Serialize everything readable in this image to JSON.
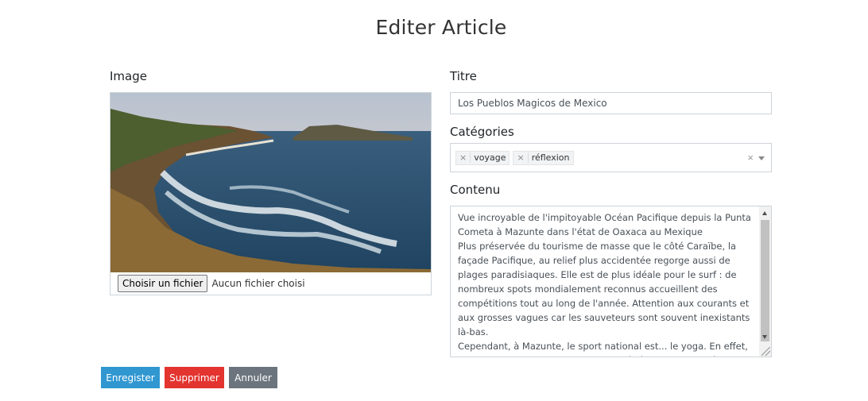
{
  "page": {
    "title": "Editer Article"
  },
  "form": {
    "image_label": "Image",
    "title_label": "Titre",
    "title_value": "Los Pueblos Magicos de Mexico",
    "categories_label": "Catégories",
    "categories": [
      "voyage",
      "réflexion"
    ],
    "content_label": "Contenu",
    "content_value": "Vue incroyable de l'impitoyable Océan Pacifique depuis la Punta Cometa à Mazunte dans l'état de Oaxaca au Mexique\nPlus préservée du tourisme de masse que le côté Caraïbe, la façade Pacifique, au relief plus accidentée regorge aussi de plages paradisiaques. Elle est de plus idéale pour le surf : de nombreux spots mondialement reconnus accueillent des compétitions tout au long de l'année. Attention aux courants et aux grosses vagues car les sauveteurs sont souvent inexistants là-bas.\nCependant, à Mazunte, le sport national est... le yoga. En effet, entre ambiance baba cool et climat rêvé, le cadre se prête parfaitement à la"
  },
  "file_input": {
    "button_label": "Choisir un fichier",
    "status": "Aucun fichier choisi"
  },
  "icons": {
    "tag_remove": "×",
    "clear": "×"
  },
  "actions": {
    "save_label": "Enregister",
    "delete_label": "Supprimer",
    "cancel_label": "Annuler"
  },
  "colors": {
    "save": "#3097d1",
    "delete": "#e3342f",
    "cancel": "#6c757d"
  }
}
